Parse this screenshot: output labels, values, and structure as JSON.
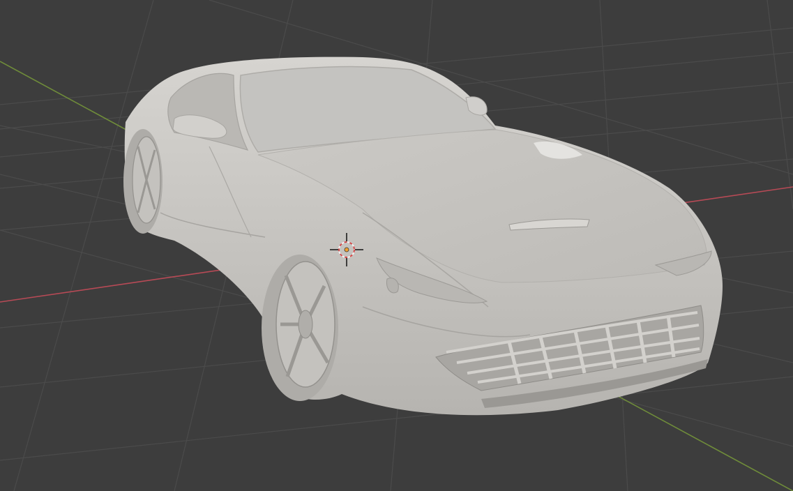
{
  "viewport": {
    "background_color": "#3d3d3d",
    "grid_line_color": "#4b4b4b",
    "x_axis_color": "#b84a56",
    "y_axis_color": "#6f8c3a"
  },
  "scene": {
    "object": "car-model",
    "shading": "solid",
    "body_color": "#c8c6c2",
    "shadow_color": "#9e9c98",
    "highlight_color": "#dcdad6"
  },
  "cursor_3d": {
    "icon": "3d-cursor-icon",
    "ring_color_a": "#d24b4b",
    "ring_color_b": "#f2f2f2",
    "origin_color": "#f0a030"
  }
}
